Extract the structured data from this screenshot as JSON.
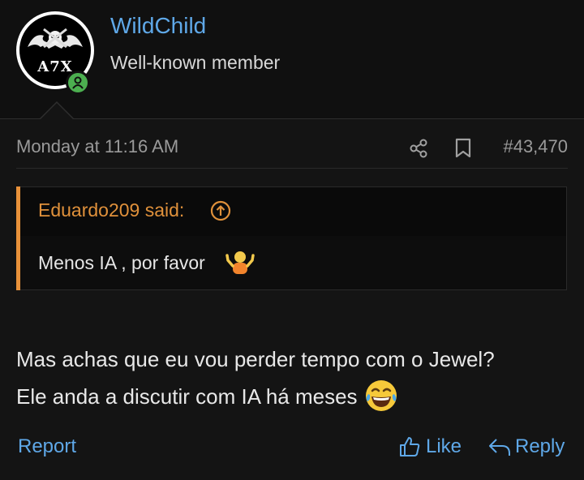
{
  "user": {
    "name": "WildChild",
    "title": "Well-known member",
    "avatar_text": "A7X",
    "online": true
  },
  "post": {
    "date": "Monday at 11:16 AM",
    "number": "#43,470",
    "quote": {
      "author": "Eduardo209 said:",
      "text": "Menos IA , por favor"
    },
    "message_line1": "Mas achas que eu vou perder tempo com o Jewel?",
    "message_line2": "Ele anda a discutir com IA há meses"
  },
  "actions": {
    "report": "Report",
    "like": "Like",
    "reply": "Reply"
  },
  "colors": {
    "background": "#101010",
    "post_background": "#141414",
    "link": "#5fa8e8",
    "quote_accent": "#e8913a",
    "online": "#4caf50"
  },
  "icons": [
    "share-icon",
    "bookmark-icon",
    "arrow-up-circle-icon",
    "shrug-emoji-icon",
    "laughing-emoji-icon",
    "thumbs-up-icon",
    "reply-arrow-icon",
    "deathbat-logo-icon"
  ]
}
